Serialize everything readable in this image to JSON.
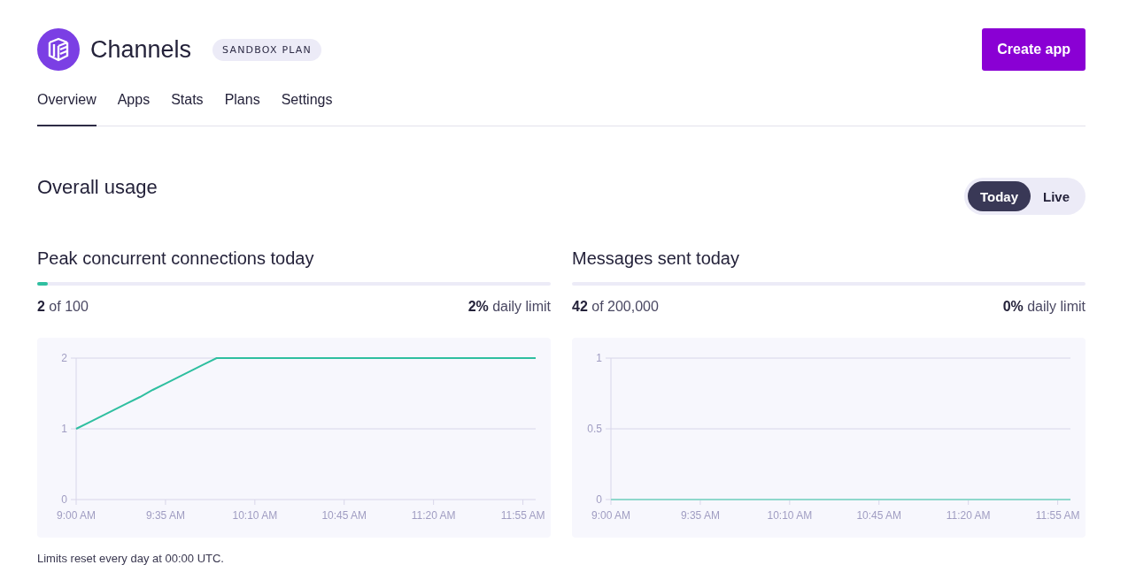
{
  "header": {
    "title": "Channels",
    "plan_badge": "SANDBOX PLAN",
    "create_button": "Create app"
  },
  "tabs": [
    {
      "label": "Overview",
      "selected": true
    },
    {
      "label": "Apps",
      "selected": false
    },
    {
      "label": "Stats",
      "selected": false
    },
    {
      "label": "Plans",
      "selected": false
    },
    {
      "label": "Settings",
      "selected": false
    }
  ],
  "usage": {
    "title": "Overall usage",
    "toggle": [
      {
        "label": "Today",
        "selected": true
      },
      {
        "label": "Live",
        "selected": false
      }
    ]
  },
  "panels": [
    {
      "title": "Peak concurrent connections today",
      "level": 0.02,
      "count": "**2** of 100",
      "percent": "**2%** daily limit",
      "chart_data": {
        "type": "line",
        "categories": [
          "9:00 AM",
          null,
          null,
          null,
          null,
          null,
          null,
          "9:35 AM",
          null,
          null,
          null,
          null,
          null,
          null,
          "10:10 AM",
          null,
          null,
          null,
          null,
          null,
          null,
          "10:45 AM",
          null,
          null,
          null,
          null,
          null,
          null,
          "11:20 AM",
          null,
          null,
          null,
          null,
          null,
          null,
          "11:55 AM",
          null
        ],
        "series": [
          {
            "color": "#2fbfa0",
            "values": [
              1,
              1.09,
              1.18,
              1.27,
              1.36,
              1.45,
              1.55,
              1.64,
              1.73,
              1.82,
              1.91,
              2,
              2,
              2,
              2,
              2,
              2,
              2,
              2,
              2,
              2,
              2,
              2,
              2,
              2,
              2,
              2,
              2,
              2,
              2,
              2,
              2,
              2,
              2,
              2,
              2,
              2
            ]
          }
        ],
        "ylim": [
          0,
          2
        ],
        "yticks": [
          0,
          1,
          2
        ]
      }
    },
    {
      "title": "Messages sent today",
      "count": "**42** of 200,000",
      "percent": "**0%** daily limit",
      "chart_data": {
        "type": "line",
        "categories": [
          "9:00 AM",
          null,
          null,
          null,
          null,
          null,
          null,
          "9:35 AM",
          null,
          null,
          null,
          null,
          null,
          null,
          "10:10 AM",
          null,
          null,
          null,
          null,
          null,
          null,
          "10:45 AM",
          null,
          null,
          null,
          null,
          null,
          null,
          "11:20 AM",
          null,
          null,
          null,
          null,
          null,
          null,
          "11:55 AM",
          null
        ],
        "series": [
          {
            "color": "#8fd8cc",
            "values": [
              0,
              0,
              0,
              0,
              0,
              0,
              0,
              0,
              0,
              0,
              0,
              0,
              0,
              0,
              0,
              0,
              0,
              0,
              0,
              0,
              0,
              0,
              0,
              0,
              0,
              0,
              0,
              0,
              0,
              0,
              0,
              0,
              0,
              0,
              0,
              0,
              0
            ]
          }
        ],
        "ylim": [
          0,
          1
        ],
        "yticks": [
          0,
          0.5,
          1
        ]
      }
    }
  ],
  "footnote": "Limits reset every day at 00:00 UTC."
}
